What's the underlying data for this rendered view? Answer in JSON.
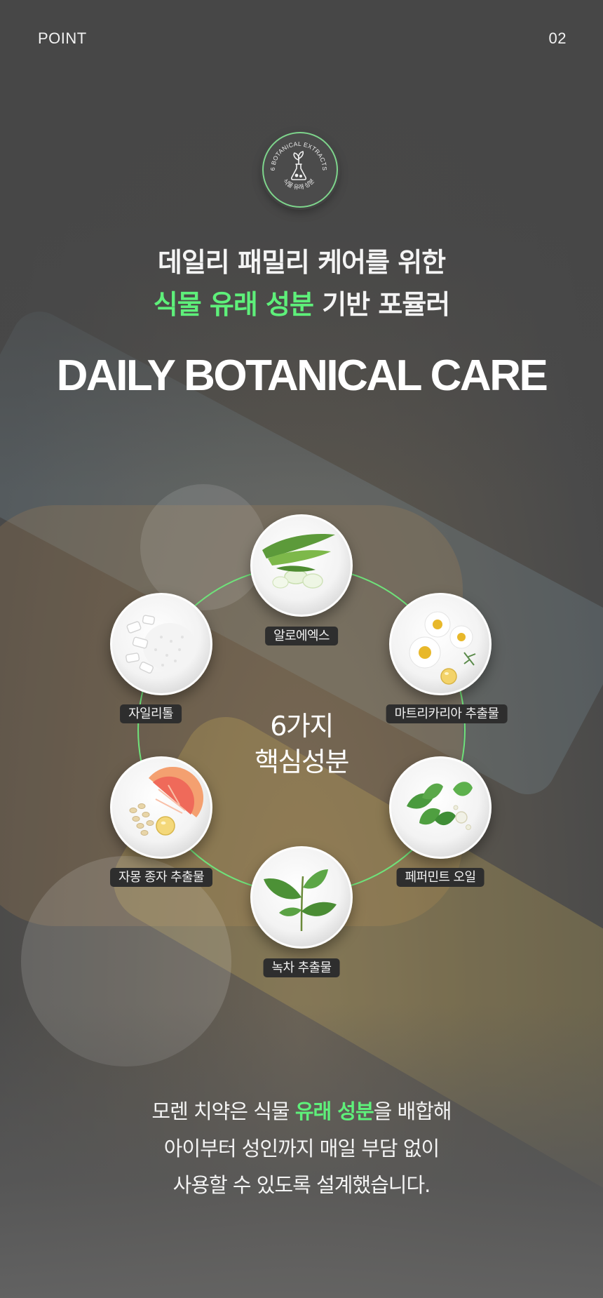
{
  "header": {
    "section_label": "POINT",
    "page_number": "02"
  },
  "badge": {
    "text_top": "6 BOTANICAL EXTRACTS",
    "text_bottom": "식물 유래 성분",
    "icon": "sprout-flask-icon",
    "ring_color": "#7ed58c"
  },
  "headline": {
    "line1": "데일리 패밀리 케어를 위한",
    "line2_highlight": "식물 유래 성분",
    "line2_rest": " 기반 포뮬러",
    "highlight_color": "#5ef07a"
  },
  "title_en": "DAILY BOTANICAL CARE",
  "diagram": {
    "center_line1": "6가지",
    "center_line2": "핵심성분",
    "ring_color": "#6fe27a",
    "ingredients": [
      {
        "label": "알로에엑스",
        "icon": "aloe-icon"
      },
      {
        "label": "마트리카리아 추출물",
        "icon": "chamomile-icon"
      },
      {
        "label": "페퍼민트 오일",
        "icon": "peppermint-icon"
      },
      {
        "label": "녹차 추출물",
        "icon": "green-tea-icon"
      },
      {
        "label": "자몽 종자 추출물",
        "icon": "grapefruit-icon"
      },
      {
        "label": "자일리톨",
        "icon": "xylitol-icon"
      }
    ]
  },
  "body": {
    "line1_before": "모렌 치약은 식물 ",
    "line1_highlight": "유래 성분",
    "line1_after": "을 배합해",
    "line2": "아이부터 성인까지 매일 부담 없이",
    "line3": "사용할 수 있도록 설계했습니다."
  }
}
